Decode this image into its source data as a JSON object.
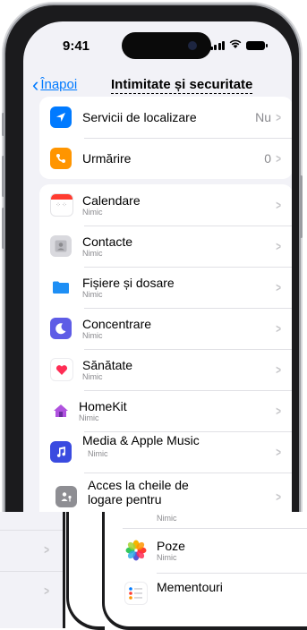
{
  "status": {
    "time": "9:41"
  },
  "nav": {
    "back_label": "Înapoi",
    "title": "Intimitate și securitate"
  },
  "group1": [
    {
      "label": "Servicii de localizare",
      "value": "Nu",
      "icon": "location-arrow-icon",
      "color": "#007aff"
    },
    {
      "label": "Urmărire",
      "value": "0",
      "icon": "tracking-icon",
      "color": "#ff9500"
    }
  ],
  "group2": [
    {
      "label": "Calendare",
      "sub": "Nimic",
      "icon": "calendar-icon"
    },
    {
      "label": "Contacte",
      "sub": "Nimic",
      "icon": "contacts-icon"
    },
    {
      "label": "Fișiere și dosare",
      "sub": "Nimic",
      "icon": "folder-icon"
    },
    {
      "label": "Concentrare",
      "sub": "Nimic",
      "icon": "moon-icon"
    },
    {
      "label": "Sănătate",
      "sub": "Nimic",
      "icon": "heart-icon"
    },
    {
      "label": "HomeKit",
      "sub": "Nimic",
      "icon": "home-icon"
    },
    {
      "label": "Media & Apple Music",
      "sub": "Nimic",
      "icon": "music-icon"
    },
    {
      "label": "Acces la cheile de logare pentru",
      "sub": "",
      "icon": "passkey-icon"
    }
  ],
  "overlay": [
    {
      "label": "",
      "sub": "Nimic"
    },
    {
      "label": "Poze",
      "sub": "Nimic",
      "icon": "photos-icon"
    },
    {
      "label": "Mementouri",
      "sub": "",
      "icon": "reminders-icon"
    }
  ]
}
